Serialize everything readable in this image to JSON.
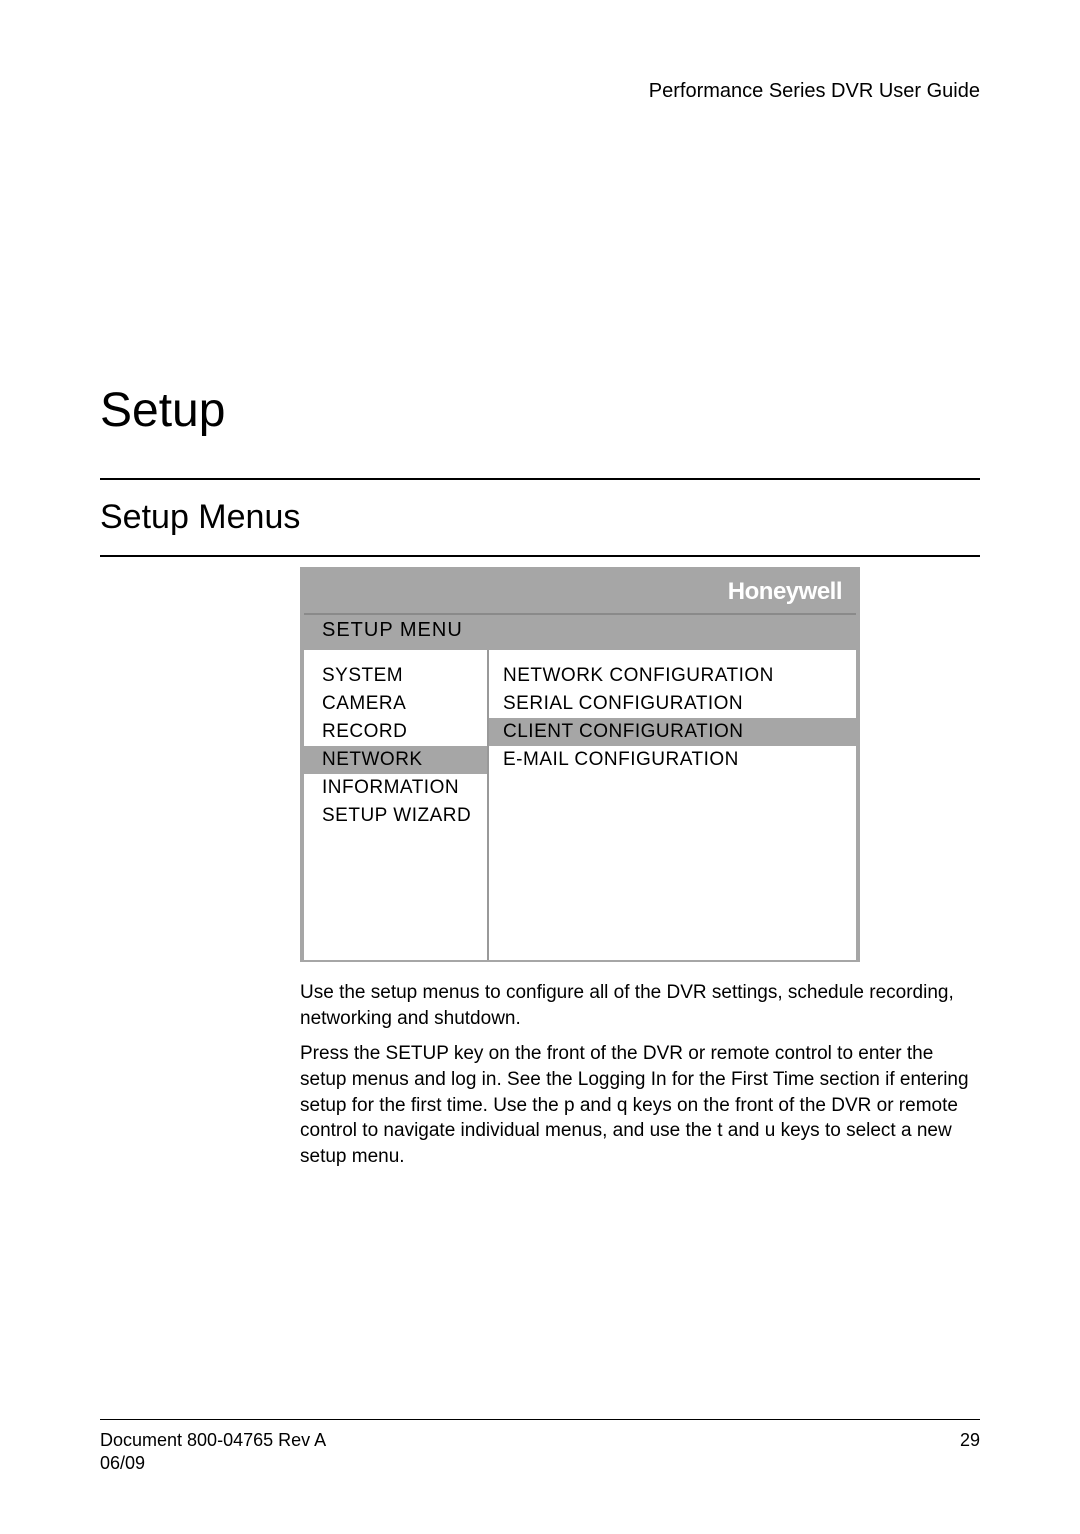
{
  "header": {
    "doc_title": "Performance Series DVR User Guide"
  },
  "chapter": {
    "title": "Setup"
  },
  "section": {
    "title": "Setup Menus"
  },
  "screenshot": {
    "logo": "Honeywell",
    "menu_title": "SETUP MENU",
    "left_items": [
      {
        "label": "SYSTEM",
        "selected": false
      },
      {
        "label": "CAMERA",
        "selected": false
      },
      {
        "label": "RECORD",
        "selected": false
      },
      {
        "label": "NETWORK",
        "selected": true
      },
      {
        "label": "INFORMATION",
        "selected": false
      },
      {
        "label": "SETUP WIZARD",
        "selected": false
      }
    ],
    "right_items": [
      {
        "label": "NETWORK CONFIGURATION",
        "selected": false
      },
      {
        "label": "SERIAL CONFIGURATION",
        "selected": false
      },
      {
        "label": "CLIENT CONFIGURATION",
        "selected": true
      },
      {
        "label": "E-MAIL CONFIGURATION",
        "selected": false
      }
    ]
  },
  "body": {
    "p1": "Use the setup menus to configure all of the DVR settings, schedule recording, networking and shutdown.",
    "p2": "Press the SETUP key on the front of the DVR or remote control to enter the setup menus and log in. See the Logging In for the First Time section if entering setup for the first time. Use the p  and q  keys on the front of the DVR or remote control to navigate individual menus, and use the t  and u  keys to select a new setup menu."
  },
  "footer": {
    "doc_id": "Document 800-04765  Rev A",
    "page": "29",
    "date": "06/09"
  }
}
